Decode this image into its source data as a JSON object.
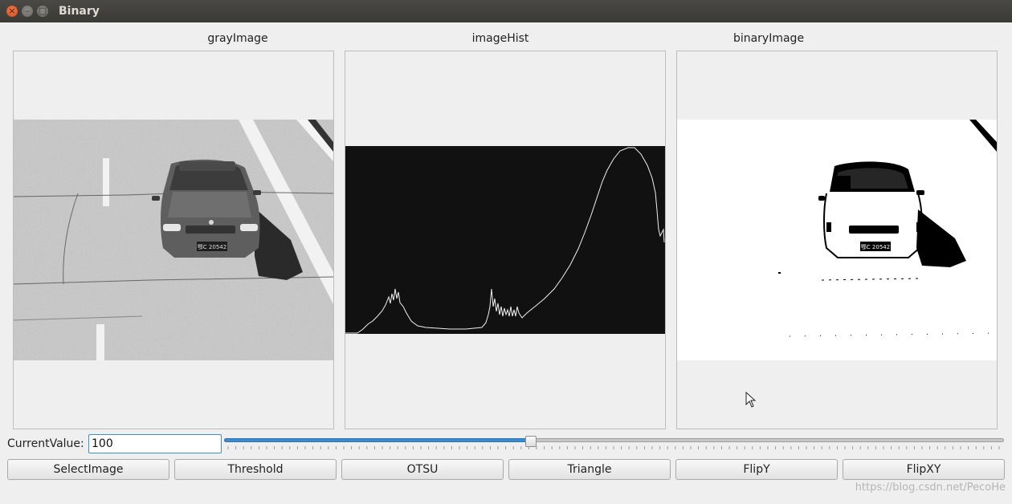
{
  "window": {
    "title": "Binary"
  },
  "panels": {
    "gray": {
      "label": "grayImage"
    },
    "hist": {
      "label": "imageHist"
    },
    "binary": {
      "label": "binaryImage"
    }
  },
  "image_text": {
    "plate": "鄂C 20542"
  },
  "controls": {
    "current_label": "CurrentValue:",
    "current_value": "100",
    "slider_value": 100,
    "slider_max": 255
  },
  "buttons": [
    "SelectImage",
    "Threshold",
    "OTSU",
    "Triangle",
    "FlipY",
    "FlipXY"
  ],
  "watermark": "https://blog.csdn.net/PecoHe",
  "colors": {
    "accent": "#3a8bd1",
    "hist_bg": "#111111"
  }
}
